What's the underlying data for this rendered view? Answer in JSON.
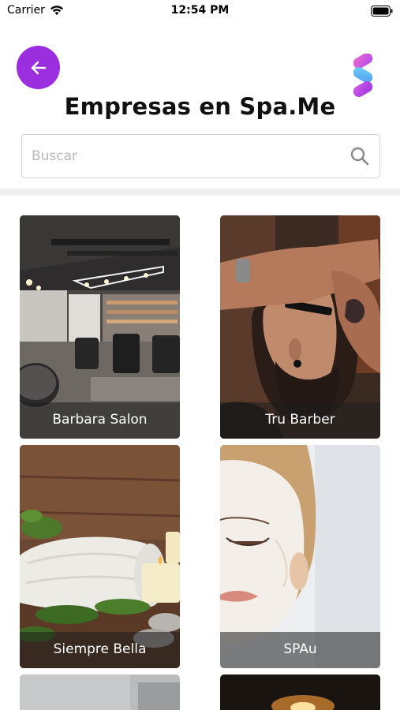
{
  "status_bar": {
    "carrier": "Carrier",
    "time": "12:54 PM"
  },
  "header": {
    "title": "Empresas en Spa.Me",
    "back_icon": "arrow-left-icon",
    "logo_icon": "spa-me-logo"
  },
  "search": {
    "placeholder": "Buscar",
    "value": ""
  },
  "colors": {
    "accent": "#9b2fe0",
    "logo_pink": "#e45bd6",
    "logo_blue": "#5ab8f5"
  },
  "businesses": [
    {
      "name": "Barbara Salon"
    },
    {
      "name": "Tru Barber"
    },
    {
      "name": "Siempre Bella"
    },
    {
      "name": "SPAu"
    },
    {
      "name": ""
    },
    {
      "name": ""
    }
  ]
}
